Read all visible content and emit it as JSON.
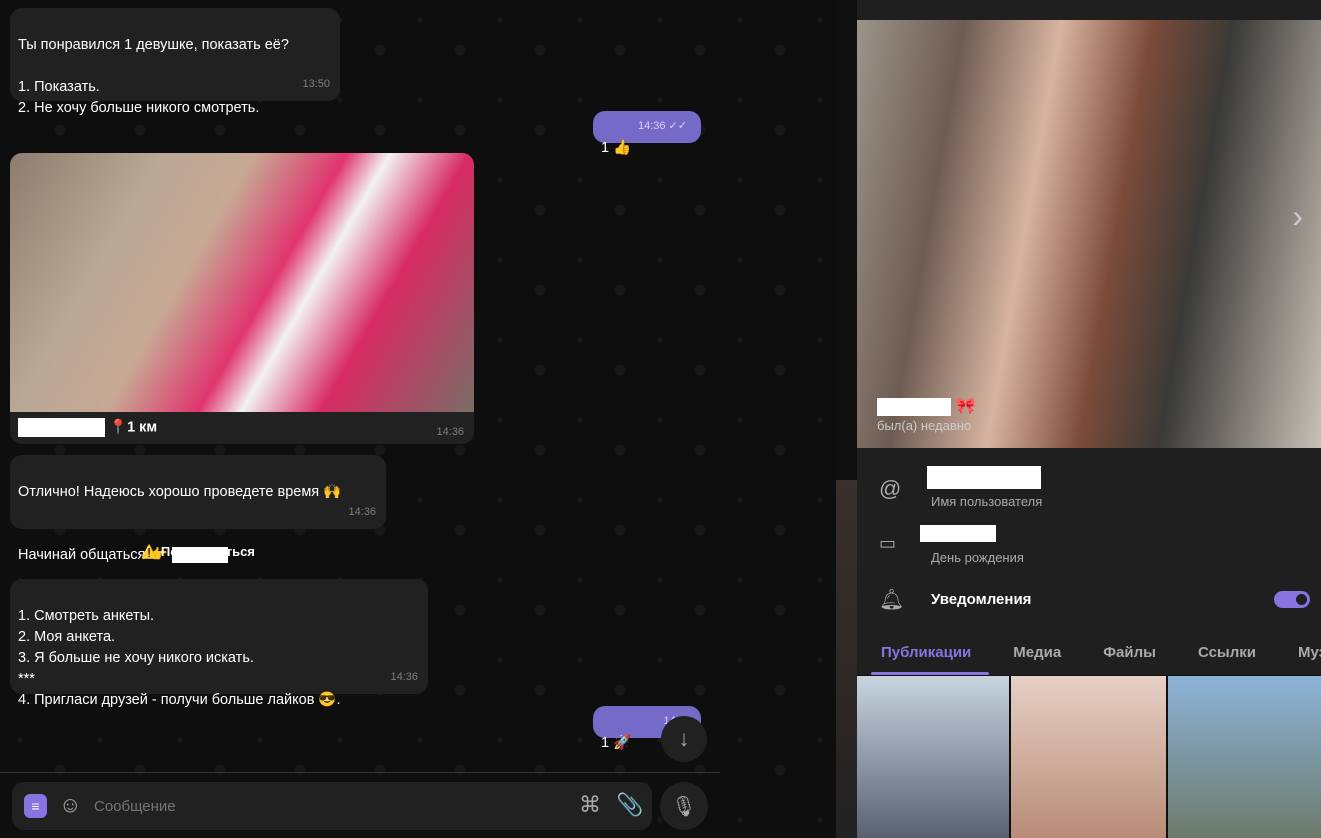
{
  "messages": [
    {
      "text": "Ты понравился 1 девушке, показать её?\n\n1. Показать.\n2. Не хочу больше никого смотреть.",
      "time": "13:50",
      "dir": "in"
    },
    {
      "text": "1 👍",
      "time": "14:36",
      "dir": "out",
      "status": "read"
    },
    {
      "caption_suffix": "📍1 км",
      "time": "14:36",
      "dir": "in",
      "type": "photo"
    },
    {
      "line1": "Отлично! Надеюсь хорошо проведете время 🙌",
      "line2": "Начинай общаться 👉",
      "time": "14:36",
      "dir": "in"
    },
    {
      "text": "1. Смотреть анкеты.\n2. Моя анкета.\n3. Я больше не хочу никого искать.\n***\n4. Пригласи друзей - получи больше лайков 😎.",
      "time": "14:36",
      "dir": "in"
    },
    {
      "text": "1 🚀",
      "time": "14:36",
      "dir": "out"
    }
  ],
  "report_button": "⚠️ Пожаловаться",
  "composer": {
    "placeholder": "Сообщение"
  },
  "profile": {
    "status": "был(а) недавно",
    "name_emoji": "🎀",
    "username_label": "Имя пользователя",
    "birthday_label": "День рождения",
    "notifications_label": "Уведомления",
    "notifications_on": true,
    "tabs": [
      "Публикации",
      "Медиа",
      "Файлы",
      "Ссылки",
      "Музы"
    ],
    "active_tab": "Публикации"
  },
  "colors": {
    "accent": "#8774e1",
    "outgoing": "#766ac8",
    "bubble": "#212121"
  }
}
